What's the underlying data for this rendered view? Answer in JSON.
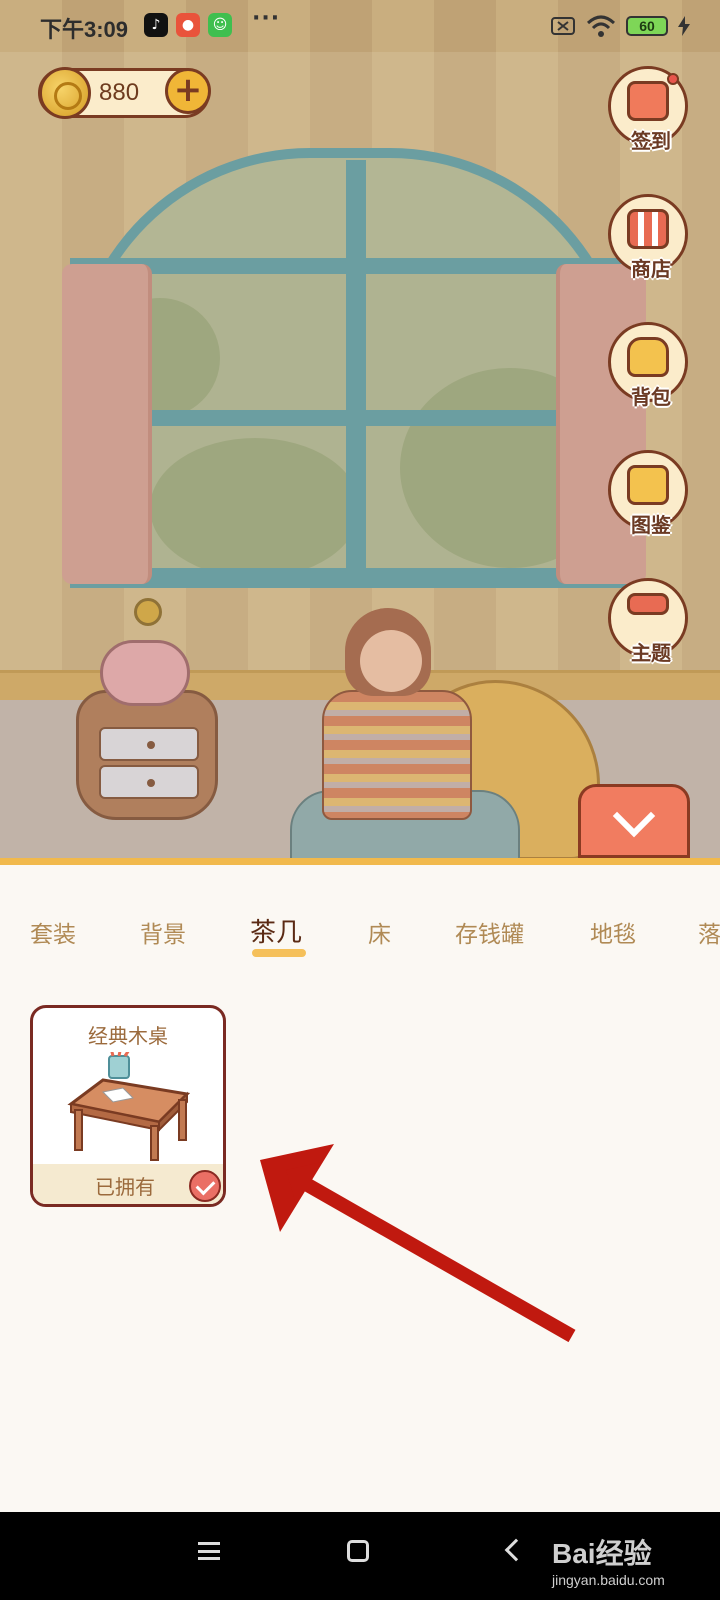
{
  "status_bar": {
    "time": "下午3:09",
    "more": "···",
    "battery": "60"
  },
  "coins": {
    "value": "880",
    "add_symbol": "+"
  },
  "side_menu": [
    {
      "label": "签到",
      "icon": "calendar-icon"
    },
    {
      "label": "商店",
      "icon": "shop-icon"
    },
    {
      "label": "背包",
      "icon": "backpack-icon"
    },
    {
      "label": "图鉴",
      "icon": "book-icon"
    },
    {
      "label": "主题",
      "icon": "paint-roller-icon"
    }
  ],
  "tabs": [
    {
      "label": "套装"
    },
    {
      "label": "背景"
    },
    {
      "label": "茶几",
      "active": true
    },
    {
      "label": "床"
    },
    {
      "label": "存钱罐"
    },
    {
      "label": "地毯"
    },
    {
      "label": "落"
    }
  ],
  "items": [
    {
      "name": "经典木桌",
      "status": "已拥有"
    }
  ],
  "watermark": {
    "main": "Bai经验",
    "sub": "jingyan.baidu.com"
  },
  "colors": {
    "accent": "#f1b94c",
    "tab_inactive": "#b08a55",
    "tab_active": "#5b2a14",
    "annotation_arrow": "#c0190f",
    "collapse_button": "#f17c60"
  }
}
